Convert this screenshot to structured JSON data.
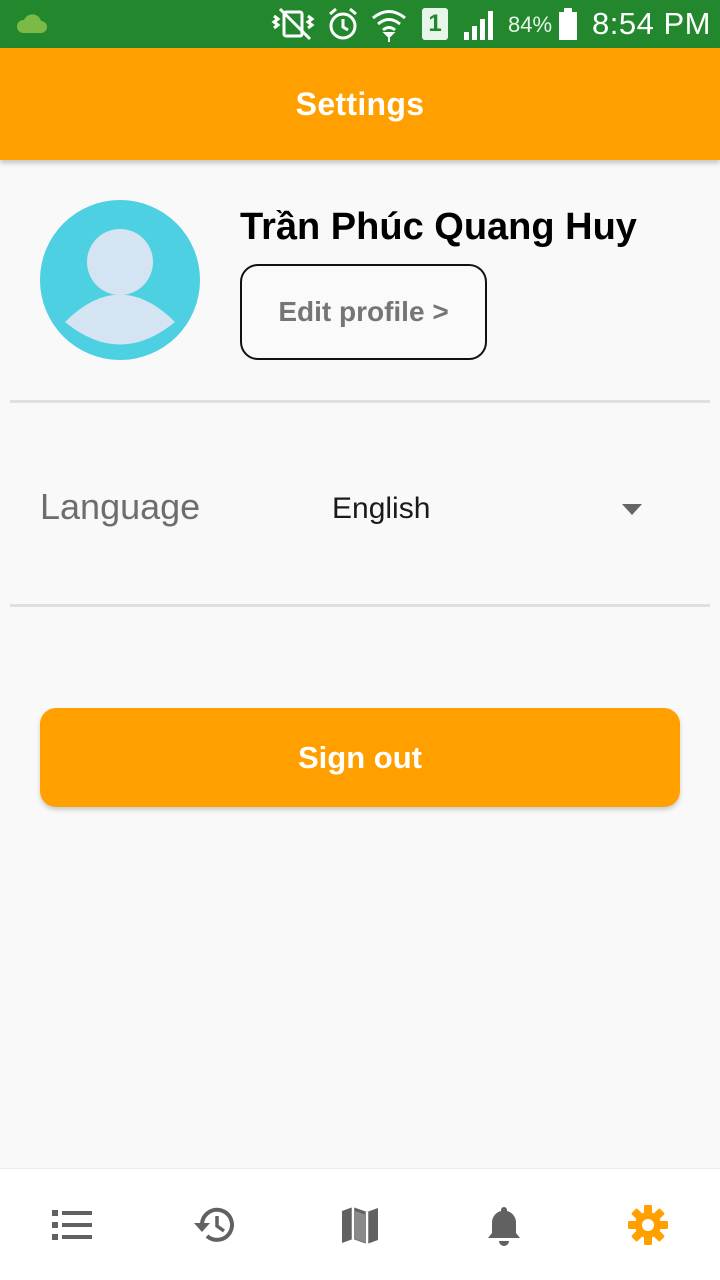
{
  "status_bar": {
    "battery_percent": "84%",
    "time": "8:54 PM",
    "sim_slot": "1",
    "icons": [
      "cloud-icon",
      "vibrate-icon",
      "alarm-icon",
      "wifi-icon",
      "sim-icon",
      "signal-icon",
      "battery-icon"
    ]
  },
  "app_bar": {
    "title": "Settings"
  },
  "profile": {
    "name": "Trần Phúc Quang Huy",
    "edit_label": "Edit profile >",
    "avatar_icon": "person-icon",
    "avatar_color": "#4dd0e1"
  },
  "language": {
    "label": "Language",
    "selected": "English"
  },
  "sign_out_label": "Sign out",
  "bottom_nav": {
    "items": [
      {
        "icon": "list-icon",
        "active": false
      },
      {
        "icon": "history-icon",
        "active": false
      },
      {
        "icon": "map-icon",
        "active": false
      },
      {
        "icon": "bell-icon",
        "active": false
      },
      {
        "icon": "gear-icon",
        "active": true
      }
    ]
  },
  "colors": {
    "accent": "#ffa000",
    "status_bar": "#23882d",
    "nav_inactive": "#616161"
  }
}
